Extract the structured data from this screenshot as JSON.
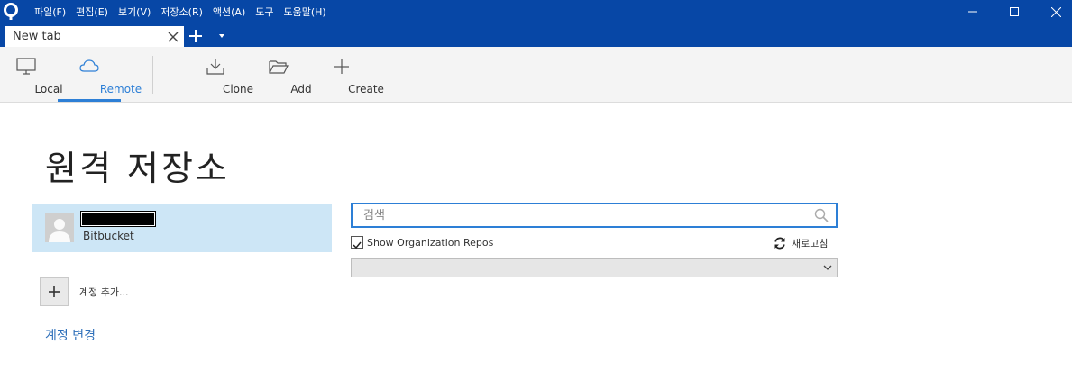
{
  "titlebar": {
    "menus": [
      "파일(F)",
      "편집(E)",
      "보기(V)",
      "저장소(R)",
      "액션(A)",
      "도구",
      "도움말(H)"
    ],
    "colors": {
      "bg": "#0747a6",
      "accent": "#2d7fd6"
    }
  },
  "tabs": [
    {
      "label": "New tab"
    }
  ],
  "toolbar": {
    "local": "Local",
    "remote": "Remote",
    "clone": "Clone",
    "add": "Add",
    "create": "Create"
  },
  "main": {
    "title": "원격 저장소",
    "account": {
      "service": "Bitbucket"
    },
    "add_account_label": "계정 추가...",
    "change_account_label": "계정 변경",
    "search": {
      "placeholder": "검색",
      "value": ""
    },
    "show_org_repos": {
      "label": "Show Organization Repos",
      "checked": true
    },
    "refresh_label": "새로고침",
    "select_value": ""
  }
}
